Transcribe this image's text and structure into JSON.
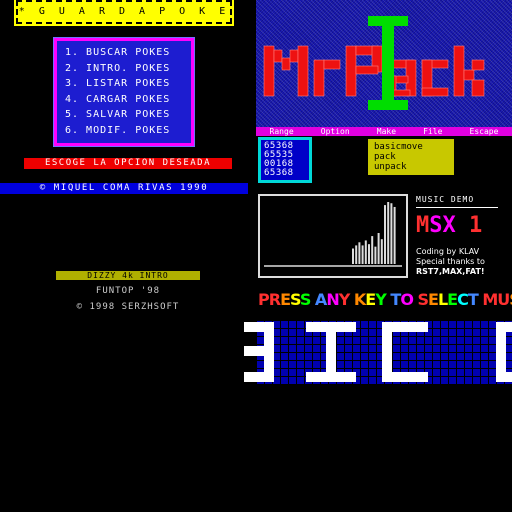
{
  "guarda_pokes": {
    "title": "* G U A R D A   P O K E S *",
    "menu": [
      "1. BUSCAR POKES",
      "2. INTRO. POKES",
      "3. LISTAR POKES",
      "4. CARGAR POKES",
      "5. SALVAR POKES",
      "6. MODIF. POKES"
    ],
    "prompt": "ESCOGE LA OPCION DESEADA",
    "copyright": "© MIQUEL COMA RIVAS  1990",
    "colors": {
      "title_bg": "#ffff00",
      "menu_bg": "#1d1dd0",
      "menu_border": "#ff00ff",
      "prompt_bg": "#ee0000",
      "copyright_bg": "#0000dd"
    }
  },
  "dizzy": {
    "bar": "DIZZY 4k INTRO",
    "line1": "FUNTOP '98",
    "line2": "© 1998 SERZHSOFT"
  },
  "mrpack": {
    "logo": "MrPack",
    "menu": [
      "Range",
      "Option",
      "Make",
      "File",
      "Escape"
    ],
    "numbers": [
      "65368",
      "65535",
      "00168",
      "65368"
    ],
    "options": [
      "basicmove",
      "pack",
      "unpack"
    ],
    "colors": {
      "logo": "#ee1111",
      "accent": "#00dd00",
      "menu_bg": "#e000e0",
      "opts_bg": "#c8c800"
    }
  },
  "music_demo": {
    "title": "MUSIC DEMO",
    "msx_label": "MSX 1",
    "credit1": "Coding by KLAV",
    "credit2": "Special thanks to",
    "credit3": "RST7,MAX,FAT!",
    "press": "PRESS ANY KEY TO SELECT MUSIC",
    "press_colors": [
      "#ff3030",
      "#ff3030",
      "#ff8800",
      "#ffff00",
      "#00ff00",
      "#00ffff",
      "#4488ff",
      "#ff00ff"
    ],
    "spectrum_levels": [
      0.25,
      0.3,
      0.35,
      0.3,
      0.38,
      0.32,
      0.45,
      0.28,
      0.5,
      0.4,
      0.95,
      1.0,
      0.98,
      0.92
    ]
  },
  "big_text": {
    "letters": "SICD"
  }
}
